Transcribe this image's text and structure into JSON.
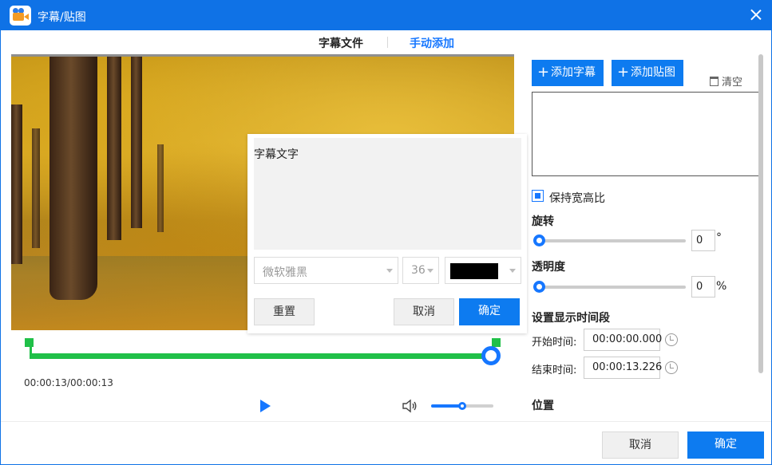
{
  "window": {
    "title": "字幕/贴图"
  },
  "tabs": [
    {
      "label": "字幕文件"
    },
    {
      "label": "手动添加"
    }
  ],
  "editor": {
    "text": "字幕文字",
    "font": "微软雅黑",
    "size": "36",
    "color": "#000000",
    "reset_label": "重置",
    "cancel_label": "取消",
    "ok_label": "确定"
  },
  "player": {
    "time": "00:00:13/00:00:13",
    "timeline_start_fraction": 0.0,
    "timeline_end_fraction": 1.0,
    "volume_fraction": 0.5
  },
  "panel": {
    "add_subtitle_label": "添加字幕",
    "add_sticker_label": "添加贴图",
    "clear_label": "清空",
    "keep_ratio_label": "保持宽高比",
    "keep_ratio_checked": true,
    "rotation_label": "旋转",
    "rotation_value": "0",
    "rotation_unit": "°",
    "opacity_label": "透明度",
    "opacity_value": "0",
    "opacity_unit": "%",
    "time_section_label": "设置显示时间段",
    "start_label": "开始时间:",
    "start_value": "00:00:00.000",
    "end_label": "结束时间:",
    "end_value": "00:00:13.226",
    "position_label": "位置"
  },
  "footer": {
    "cancel_label": "取消",
    "ok_label": "确定"
  },
  "colors": {
    "accent": "#0d7bf0",
    "timeline": "#20c048"
  }
}
